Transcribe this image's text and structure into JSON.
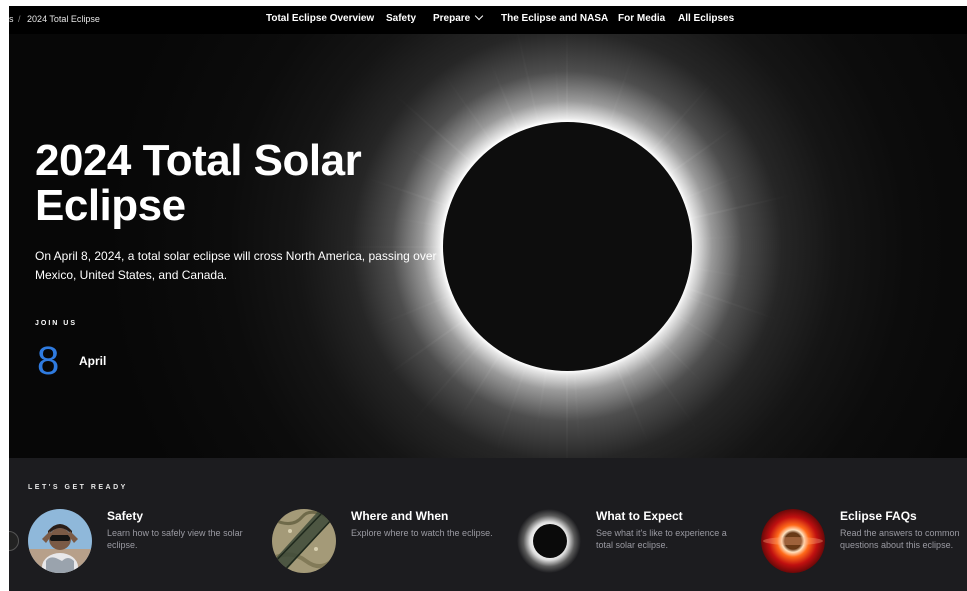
{
  "breadcrumb": {
    "prefix": "s",
    "current": "2024 Total Eclipse"
  },
  "nav": {
    "items": [
      {
        "label": "Total Eclipse Overview"
      },
      {
        "label": "Safety"
      },
      {
        "label": "Prepare"
      },
      {
        "label": "The Eclipse and NASA"
      },
      {
        "label": "For Media"
      },
      {
        "label": "All Eclipses"
      }
    ]
  },
  "hero": {
    "title": "2024 Total Solar Eclipse",
    "subtitle": "On April 8, 2024, a total solar eclipse will cross North America, passing over Mexico, United States, and Canada.",
    "join_label": "JOIN US",
    "date_day": "8",
    "date_month": "April"
  },
  "ready": {
    "label": "LET'S GET READY",
    "cards": [
      {
        "title": "Safety",
        "desc": "Learn how to safely view the solar eclipse.",
        "icon": "person-with-eclipse-glasses"
      },
      {
        "title": "Where and When",
        "desc": "Explore where to watch the eclipse.",
        "icon": "eclipse-path-map"
      },
      {
        "title": "What to Expect",
        "desc": "See what it's like to experience a total solar eclipse.",
        "icon": "total-eclipse-corona"
      },
      {
        "title": "Eclipse FAQs",
        "desc": "Read the answers to common questions about this eclipse.",
        "icon": "solar-prominence-sun"
      }
    ]
  },
  "colors": {
    "accent": "#2f7be0",
    "background": "#000000",
    "panel": "#1c1c1f"
  }
}
